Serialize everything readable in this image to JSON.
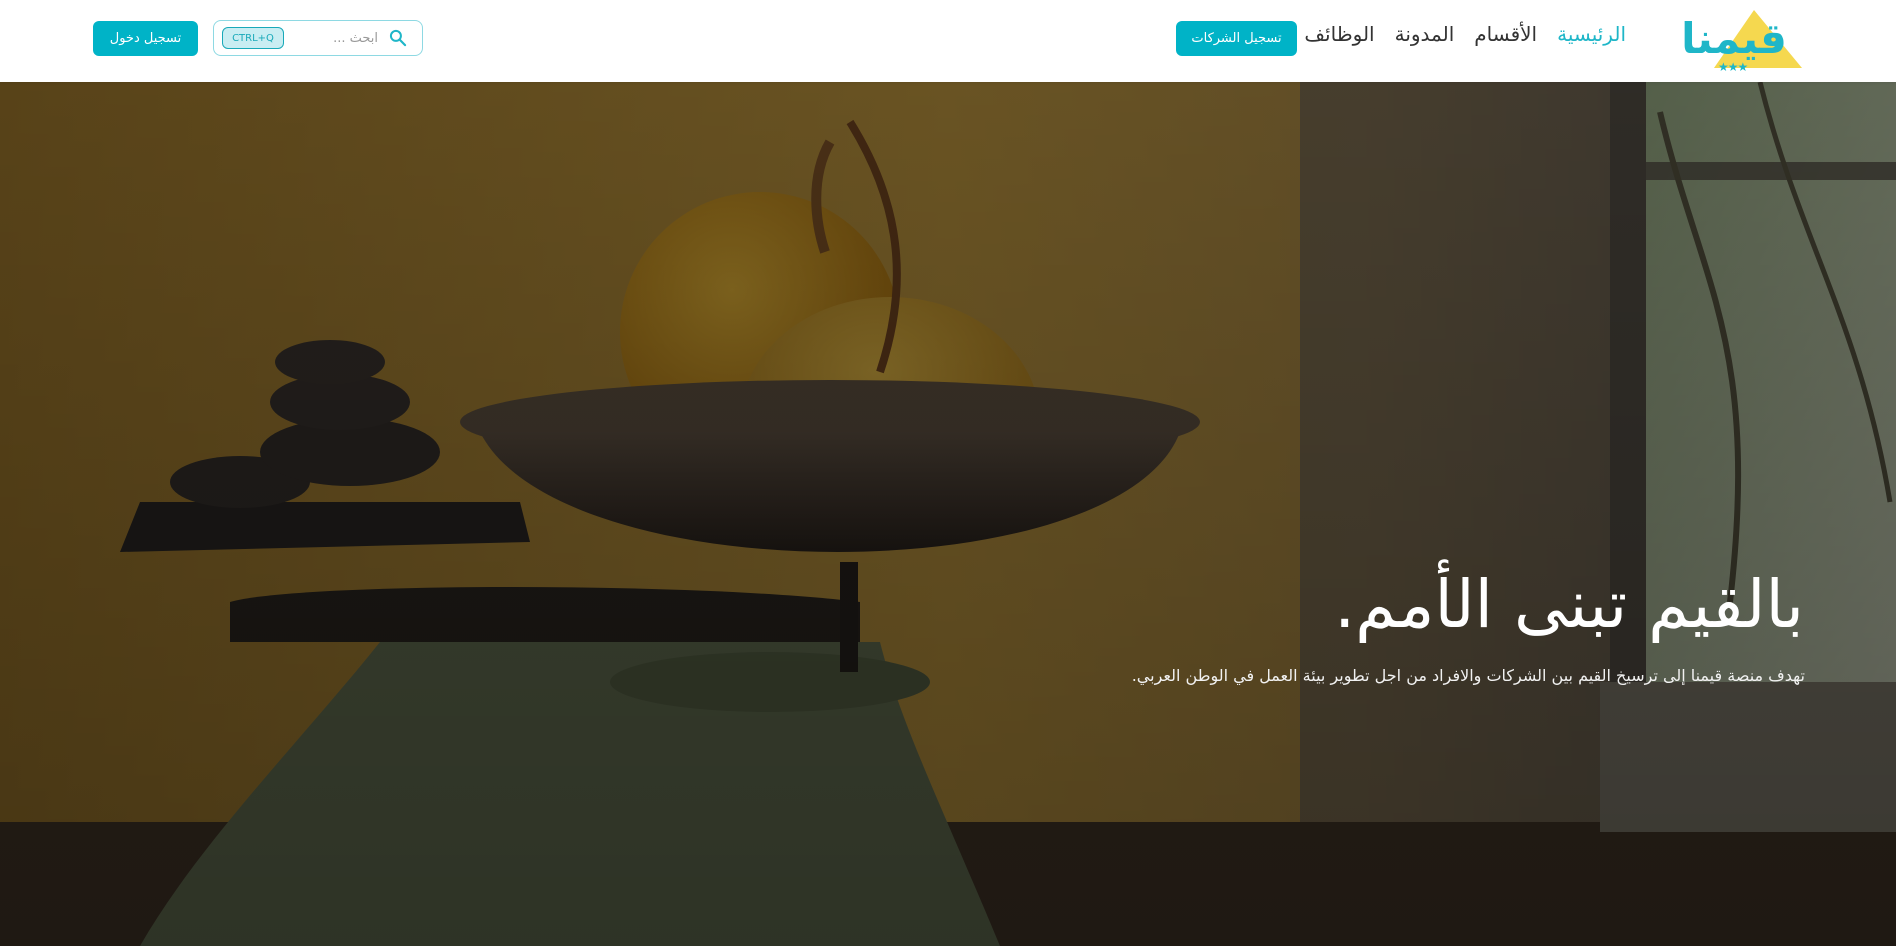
{
  "brand": {
    "logo_text": "قيمنا",
    "logo_stars": "★★★",
    "accent_color": "#00b3c7",
    "logo_triangle_color": "#f5d84f"
  },
  "nav": {
    "items": [
      {
        "label": "الرئيسية",
        "active": true
      },
      {
        "label": "الأقسام",
        "active": false
      },
      {
        "label": "المدونة",
        "active": false
      },
      {
        "label": "الوظائف",
        "active": false
      }
    ],
    "register_companies_label": "تسجيل الشركات"
  },
  "search": {
    "placeholder": "ابحث ...",
    "shortcut": "CTRL+Q",
    "icon": "search-icon"
  },
  "auth": {
    "login_label": "تسجيل دخول"
  },
  "hero": {
    "title": "بالقيم تبنى الأمم.",
    "subtitle": "تهدف منصة قيمنا إلى ترسيخ القيم بين الشركات والافراد من اجل تطوير بيئة العمل في الوطن العربي."
  }
}
